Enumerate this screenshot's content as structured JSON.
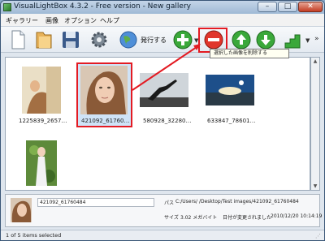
{
  "window": {
    "title": "VisualLightBox 4.3.2 - Free version - New gallery"
  },
  "menu": [
    "ギャラリー",
    "画像",
    "オプション",
    "ヘルプ"
  ],
  "toolbar": {
    "publish_label": "発行する",
    "more": "»"
  },
  "tooltip": "選択した画像を削除する",
  "gallery": {
    "items": [
      {
        "caption": "1225839_2657…",
        "selected": false
      },
      {
        "caption": "421092_61760…",
        "selected": true
      },
      {
        "caption": "580928_32280…",
        "selected": false
      },
      {
        "caption": "633847_78601…",
        "selected": false
      },
      {
        "caption": "",
        "selected": false
      }
    ]
  },
  "details": {
    "name": "421092_61760484",
    "path_label": "パス",
    "path_value": "C:/Users/          /Desktop/Test images/421092_61760484",
    "size_label": "サイズ",
    "size_value": "3.02 メガバイト",
    "modified_label": "日付が変更されました",
    "modified_value": "2010/12/20 10:14:19"
  },
  "status": "1 of 5 items selected",
  "colors": {
    "highlight": "#e31b23",
    "selection": "#cfe3f7"
  }
}
